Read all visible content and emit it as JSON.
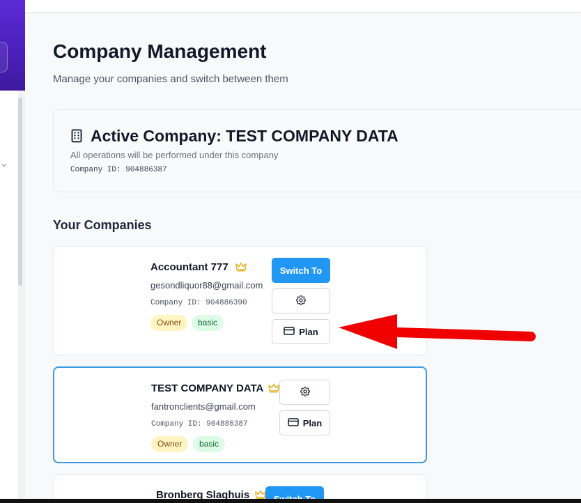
{
  "header": {
    "title": "Company Management",
    "subtitle": "Manage your companies and switch between them"
  },
  "active_company": {
    "title": "Active Company: TEST COMPANY DATA",
    "description": "All operations will be performed under this company",
    "company_id": "Company ID: 904886387",
    "icon": "building-icon"
  },
  "companies_section": {
    "title": "Your Companies"
  },
  "companies": [
    {
      "name": "Accountant 777",
      "email": "gesondliquor88@gmail.com",
      "company_id": "Company ID: 904886390",
      "role_badge": "Owner",
      "plan_badge": "basic",
      "switch_label": "Switch To",
      "plan_label": "Plan"
    },
    {
      "name": "TEST COMPANY DATA",
      "email": "fantronclients@gmail.com",
      "company_id": "Company ID: 904886387",
      "role_badge": "Owner",
      "plan_badge": "basic",
      "plan_label": "Plan"
    },
    {
      "name": "Bronberg Slaghuis",
      "switch_label": "Switch To"
    }
  ],
  "colors": {
    "primary": "#2196f3",
    "active_border": "#3b9be0",
    "owner_badge_bg": "#fef5c3",
    "basic_badge_bg": "#dcfce7",
    "crown": "#e5b21e",
    "annotation_arrow": "#f00000",
    "sidebar_brand": "#5b2bd6"
  }
}
